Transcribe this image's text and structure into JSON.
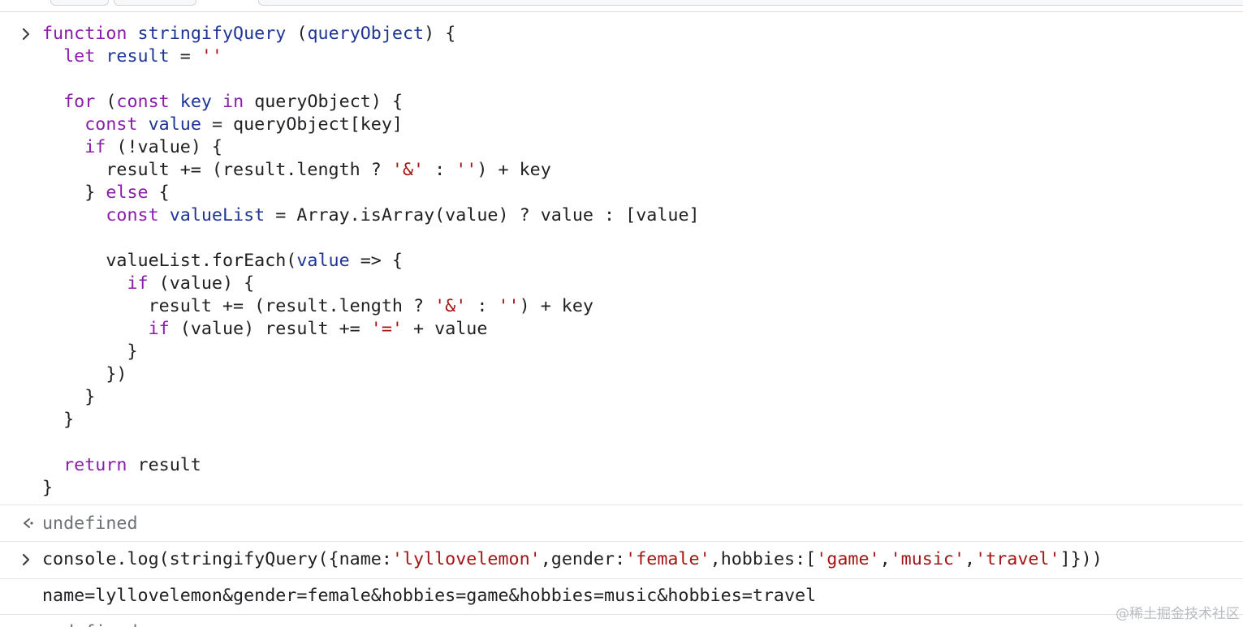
{
  "console": {
    "entry1": {
      "lines": [
        [
          [
            "kw",
            "function"
          ],
          [
            "plain",
            " "
          ],
          [
            "fn",
            "stringifyQuery"
          ],
          [
            "plain",
            " ("
          ],
          [
            "def",
            "queryObject"
          ],
          [
            "plain",
            ") {"
          ]
        ],
        [
          [
            "plain",
            "  "
          ],
          [
            "kw",
            "let"
          ],
          [
            "plain",
            " "
          ],
          [
            "def",
            "result"
          ],
          [
            "plain",
            " = "
          ],
          [
            "str",
            "''"
          ]
        ],
        [
          [
            "plain",
            ""
          ]
        ],
        [
          [
            "plain",
            "  "
          ],
          [
            "kw",
            "for"
          ],
          [
            "plain",
            " ("
          ],
          [
            "kw",
            "const"
          ],
          [
            "plain",
            " "
          ],
          [
            "def",
            "key"
          ],
          [
            "plain",
            " "
          ],
          [
            "kw",
            "in"
          ],
          [
            "plain",
            " queryObject) {"
          ]
        ],
        [
          [
            "plain",
            "    "
          ],
          [
            "kw",
            "const"
          ],
          [
            "plain",
            " "
          ],
          [
            "def",
            "value"
          ],
          [
            "plain",
            " = queryObject[key]"
          ]
        ],
        [
          [
            "plain",
            "    "
          ],
          [
            "kw",
            "if"
          ],
          [
            "plain",
            " (!value) {"
          ]
        ],
        [
          [
            "plain",
            "      result += (result.length ? "
          ],
          [
            "str",
            "'&'"
          ],
          [
            "plain",
            " : "
          ],
          [
            "str",
            "''"
          ],
          [
            "plain",
            ") + key"
          ]
        ],
        [
          [
            "plain",
            "    } "
          ],
          [
            "kw",
            "else"
          ],
          [
            "plain",
            " {"
          ]
        ],
        [
          [
            "plain",
            "      "
          ],
          [
            "kw",
            "const"
          ],
          [
            "plain",
            " "
          ],
          [
            "def",
            "valueList"
          ],
          [
            "plain",
            " = Array.isArray(value) ? value : [value]"
          ]
        ],
        [
          [
            "plain",
            ""
          ]
        ],
        [
          [
            "plain",
            "      valueList.forEach("
          ],
          [
            "def",
            "value"
          ],
          [
            "plain",
            " => {"
          ]
        ],
        [
          [
            "plain",
            "        "
          ],
          [
            "kw",
            "if"
          ],
          [
            "plain",
            " (value) {"
          ]
        ],
        [
          [
            "plain",
            "          result += (result.length ? "
          ],
          [
            "str",
            "'&'"
          ],
          [
            "plain",
            " : "
          ],
          [
            "str",
            "''"
          ],
          [
            "plain",
            ") + key"
          ]
        ],
        [
          [
            "plain",
            "          "
          ],
          [
            "kw",
            "if"
          ],
          [
            "plain",
            " (value) result += "
          ],
          [
            "str",
            "'='"
          ],
          [
            "plain",
            " + value"
          ]
        ],
        [
          [
            "plain",
            "        }"
          ]
        ],
        [
          [
            "plain",
            "      })"
          ]
        ],
        [
          [
            "plain",
            "    }"
          ]
        ],
        [
          [
            "plain",
            "  }"
          ]
        ],
        [
          [
            "plain",
            ""
          ]
        ],
        [
          [
            "plain",
            "  "
          ],
          [
            "kw",
            "return"
          ],
          [
            "plain",
            " result"
          ]
        ],
        [
          [
            "plain",
            "}"
          ]
        ]
      ]
    },
    "result1": "undefined",
    "entry2": {
      "lines": [
        [
          [
            "plain",
            "console.log(stringifyQuery({name:"
          ],
          [
            "str",
            "'lyllovelemon'"
          ],
          [
            "plain",
            ",gender:"
          ],
          [
            "str",
            "'female'"
          ],
          [
            "plain",
            ",hobbies:["
          ],
          [
            "str",
            "'game'"
          ],
          [
            "plain",
            ","
          ],
          [
            "str",
            "'music'"
          ],
          [
            "plain",
            ","
          ],
          [
            "str",
            "'travel'"
          ],
          [
            "plain",
            "]}))"
          ]
        ]
      ]
    },
    "log_output": "name=lyllovelemon&gender=female&hobbies=game&hobbies=music&hobbies=travel",
    "result2_partial": "undefined"
  },
  "watermark": "@稀土掘金技术社区",
  "icons": {
    "input_prompt": "chevron-right-icon",
    "result_prompt": "return-arrow-icon"
  },
  "colors": {
    "keyword": "#8c1cab",
    "definition": "#1f3596",
    "string": "#a31515",
    "text": "#202124",
    "muted": "#6d7278",
    "separator": "#dfe3ea"
  }
}
